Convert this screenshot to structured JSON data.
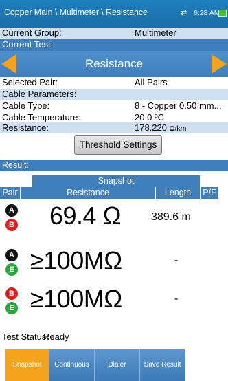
{
  "header": {
    "breadcrumb": "Copper Main \\ Multimeter \\ Resistance",
    "sync_icon": "⇄",
    "time": "6:28 AM",
    "battery_color": "#46c11e"
  },
  "info": {
    "current_group_label": "Current Group:",
    "current_group_value": "Multimeter",
    "current_test_label": "Current Test:",
    "current_test_value": "Resistance",
    "selected_pair_label": "Selected Pair:",
    "selected_pair_value": "All Pairs",
    "cable_params_label": "Cable Parameters:",
    "cable_type_label": "Cable Type:",
    "cable_type_value": "8 - Copper 0.50 mm...",
    "cable_temp_label": "Cable Temperature:",
    "cable_temp_value": "20.0 ºC",
    "resistance_label": "Resistance:",
    "resistance_value": "178.220",
    "resistance_unit": "Ω/km"
  },
  "threshold_button": "Threshold Settings",
  "result": {
    "label": "Result:",
    "snapshot_header": "Snapshot",
    "columns": {
      "pair": "Pair",
      "resistance": "Resistance",
      "length": "Length",
      "pf": "P/F"
    },
    "rows": [
      {
        "wire1": "A",
        "wire2": "B",
        "resistance": "69.4 Ω",
        "length": "389.6 m"
      },
      {
        "wire1": "A",
        "wire2": "E",
        "resistance": "≥100MΩ",
        "length": "-"
      },
      {
        "wire1": "B",
        "wire2": "E",
        "resistance": "≥100MΩ",
        "length": "-"
      }
    ]
  },
  "status": {
    "label": "Test Status:",
    "value": "Ready"
  },
  "tabs": [
    "Snapshot",
    "Continuous",
    "Dialer",
    "Save Result"
  ],
  "colors": {
    "accent": "#f5a31a",
    "header_blue": "#3e7ebd",
    "row_blue": "#cfe0f2"
  }
}
